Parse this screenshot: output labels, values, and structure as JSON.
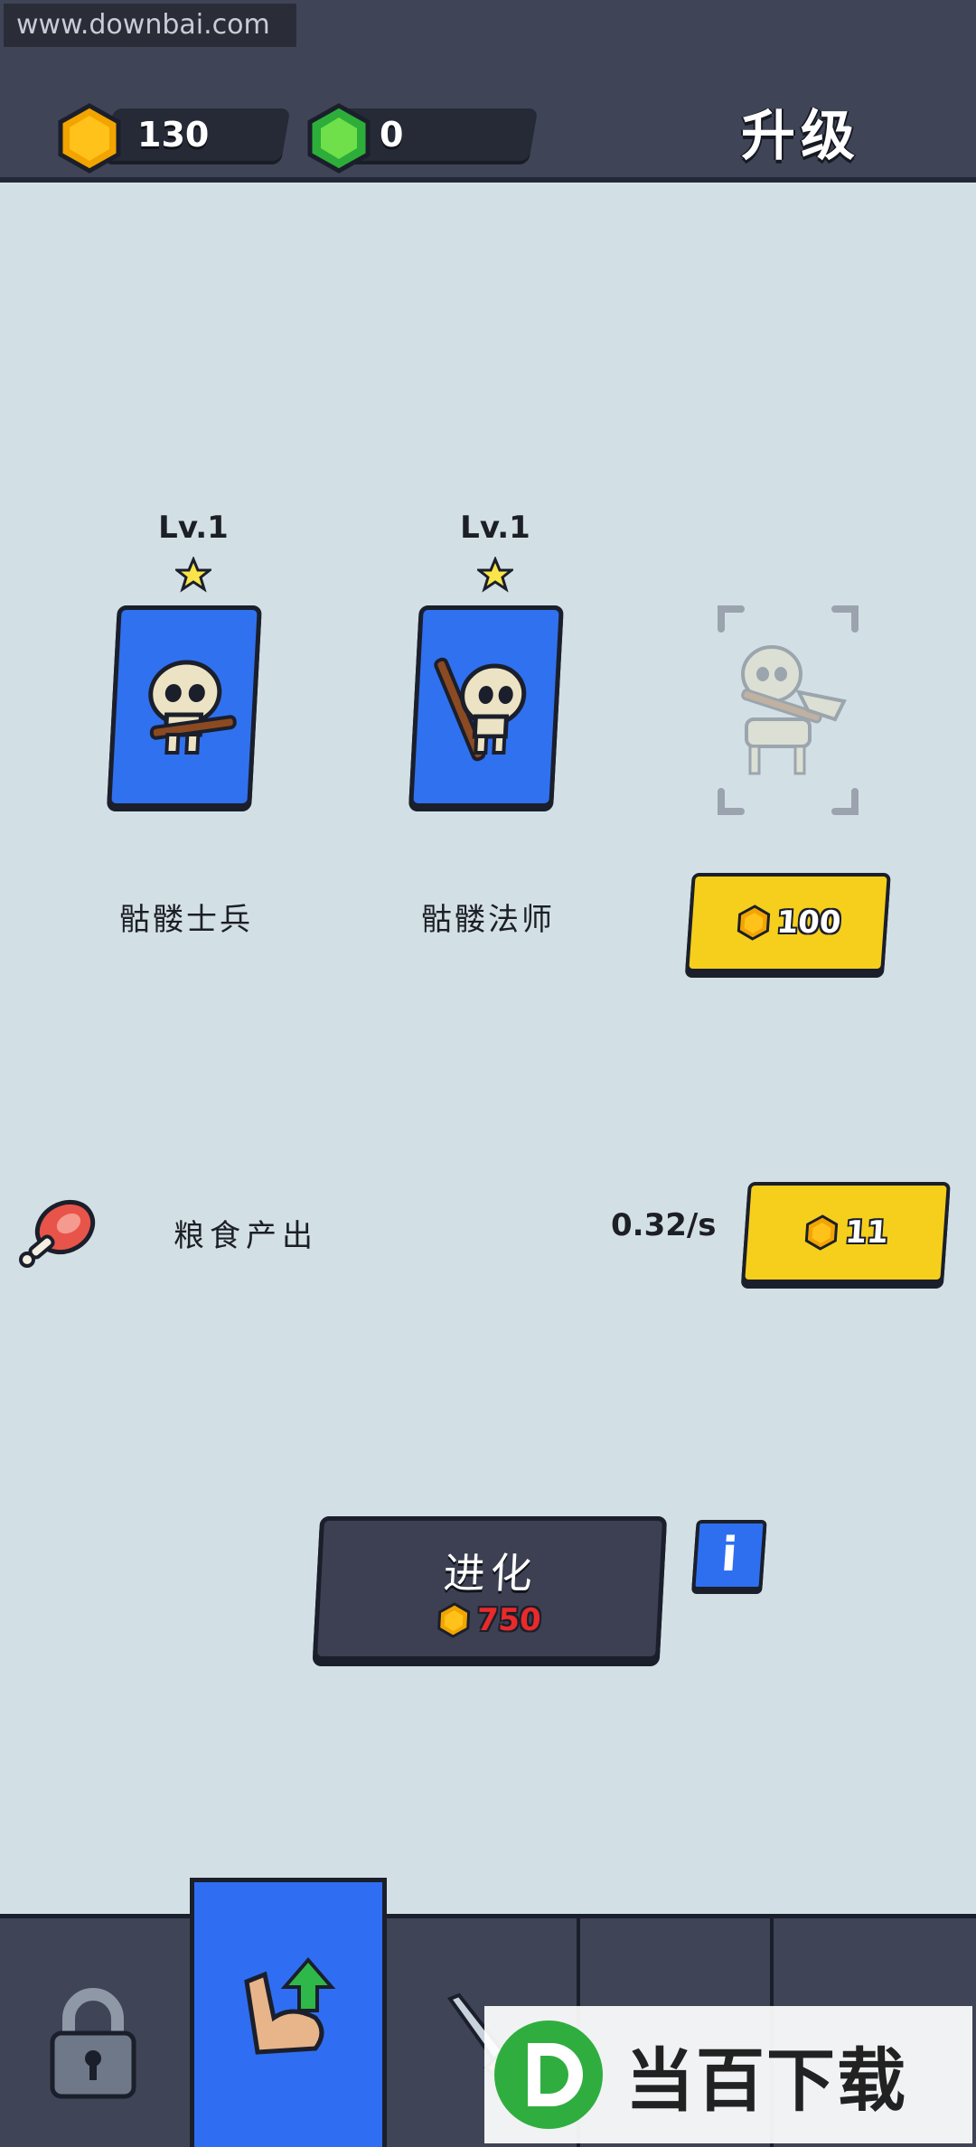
{
  "watermark_top": "www.downbai.com",
  "resources": {
    "gold": "130",
    "gems": "0"
  },
  "page_title": "升级",
  "units": [
    {
      "level": "Lv.1",
      "name": "骷髅士兵"
    },
    {
      "level": "Lv.1",
      "name": "骷髅法师"
    }
  ],
  "locked_unit": {
    "unlock_cost": "100"
  },
  "food": {
    "label": "粮食产出",
    "rate": "0.32/s",
    "upgrade_cost": "11"
  },
  "evolve": {
    "label": "进化",
    "cost": "750"
  },
  "info_button": "i",
  "bottom_nav": [
    "lock-icon",
    "arm-upgrade-icon",
    "sword-icon",
    "lock-icon",
    "lock-icon"
  ],
  "watermark_bottom": "当百下载",
  "colors": {
    "accent_blue": "#2f6ef2",
    "button_yellow": "#f6cf1c",
    "cost_red": "#e92a2a",
    "background": "#d2e0e5"
  }
}
